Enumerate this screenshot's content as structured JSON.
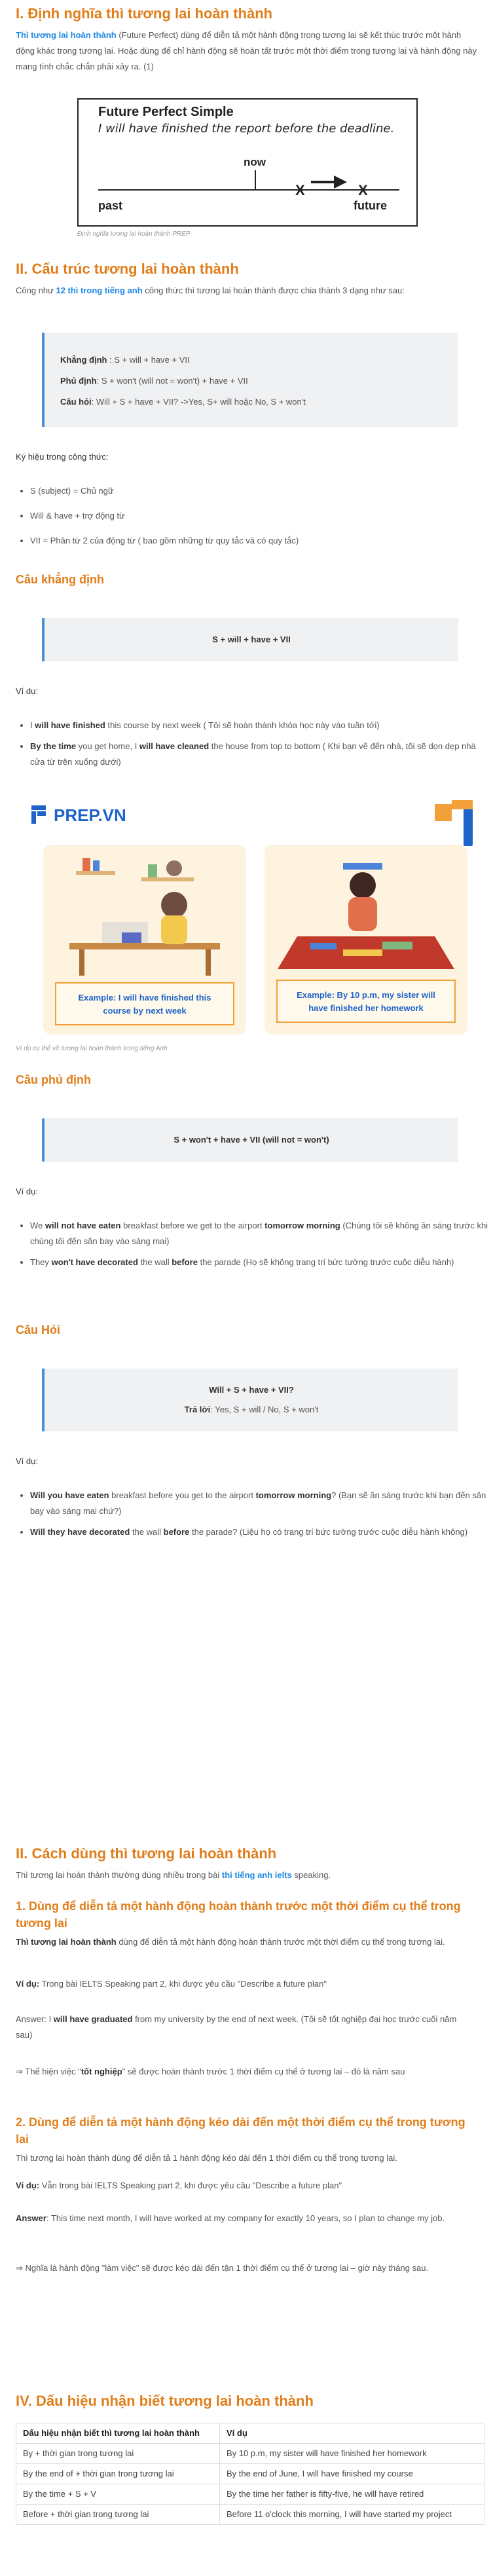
{
  "s1": {
    "title": "I. Định nghĩa thì tương lai hoàn thành",
    "intro_link": "Thì tương lai hoàn thành",
    "intro_rest": " (Future Perfect) dùng để diễn tả một hành động trong tương lai sẽ kết thúc trước một hành động khác trong tương lai. Hoặc dùng để chỉ hành động sẽ hoàn tất trước một thời điểm trong tương lai và hành động này mang tính chắc chắn phải xảy ra. (1)",
    "diagram": {
      "title": "Future Perfect Simple",
      "sentence": "I will have finished the report before the deadline.",
      "now": "now",
      "past": "past",
      "future": "future",
      "x1": "X",
      "x2": "X"
    },
    "caption": "Định nghĩa tương lai hoàn thành PREP"
  },
  "s2": {
    "title": "II. Cấu trúc tương lai hoàn thành",
    "intro_pre": "Công như ",
    "intro_link": "12 thì trong tiếng anh",
    "intro_post": " công thức thì tương lai hoàn thành được chia thành 3 dạng như sau:",
    "formula": {
      "l1_label": "Khẳng định",
      "l1": " : S + will + have + VII",
      "l2_label": "Phủ định",
      "l2": ": S + won't (will not = won't) + have + VII",
      "l3_label": "Câu hỏi",
      "l3": ": Will + S + have + VII? ->Yes, S+ will hoặc No, S + won't"
    },
    "symbols_title": "Ký hiệu trong công thức:",
    "symbols": [
      "S (subject) = Chủ ngữ",
      "Will & have + trợ động từ",
      "VII = Phân từ 2 của động từ ( bao gồm những từ quy tắc và có quy tắc)"
    ],
    "pos": {
      "title": "Câu khẳng định",
      "formula": "S + will + have + VII",
      "vidu": "Ví dụ:",
      "ex1_pre": "I ",
      "ex1_b": "will have finished",
      "ex1_post": " this course by next week ( Tôi sẽ hoàn thành khóa học này vào tuần tới)",
      "ex2_b1": "By the time",
      "ex2_m1": " you get home, I ",
      "ex2_b2": "will have cleaned",
      "ex2_post": " the house from top to bottom ( Khi bạn về đến nhà, tôi sẽ dọn dẹp nhà cửa từ trên xuống dưới)"
    },
    "illus": {
      "brand": "PREP.VN",
      "card1": "Example: I will have finished this course by next week",
      "card2": "Example: By 10 p.m, my sister will have finished her homework",
      "caption": "Ví dụ cụ thể về tương lai hoàn thành trong tiếng Anh"
    },
    "neg": {
      "title": "Câu phủ định",
      "formula": "S + won't + have + VII (will not = won't)",
      "vidu": "Ví dụ:",
      "ex1_pre": "We ",
      "ex1_b": "will not have eaten",
      "ex1_m": " breakfast before we get to the airport ",
      "ex1_b2": "tomorrow morning",
      "ex1_post": " (Chúng tôi sẽ không ăn sáng trước khi chúng tôi đến sân bay vào sáng mai)",
      "ex2_pre": "They ",
      "ex2_b": "won't have decorated",
      "ex2_m": " the wall ",
      "ex2_b2": "before",
      "ex2_post": " the parade (Họ sẽ không trang trí bức tường trước cuộc diễu hành)"
    },
    "q": {
      "title": "Câu Hỏi",
      "formula1": "Will + S + have + VII?",
      "formula2_label": "Trả lời",
      "formula2": ": Yes, S + will / No, S + won't",
      "vidu": "Ví dụ:",
      "ex1_b": "Will you have eaten",
      "ex1_m": " breakfast before you get to the airport ",
      "ex1_b2": "tomorrow morning",
      "ex1_post": "? (Bạn sẽ ăn sáng trước khi bạn đến sân bay vào sáng mai chứ?)",
      "ex2_b": "Will they have decorated",
      "ex2_m": " the wall ",
      "ex2_b2": "before",
      "ex2_post": " the parade? (Liệu họ có trang trí bức tường trước cuộc diễu hành không)"
    }
  },
  "s3": {
    "title": "II. Cách dùng thì tương lai hoàn thành",
    "intro_pre": "Thì tương lai hoàn thành thường dùng nhiều trong bài ",
    "intro_link": "thi tiếng anh ielts",
    "intro_post": " speaking.",
    "u1": {
      "title": "1. Dùng để diễn tả một hành động hoàn thành trước một thời điểm cụ thể trong tương lai",
      "desc_b": "Thì tương lai hoàn thành",
      "desc": " dùng để diễn tả một hành động hoàn thành trước một thời điểm cụ thể trong tương lai.",
      "vd_label": "Ví dụ:",
      "vd": " Trong bài IELTS Speaking part 2, khi được yêu cầu \"Describe a future plan\"",
      "ans_pre": "Answer: I ",
      "ans_b": "will have graduated",
      "ans_post": " from my university by the end of next week. (Tôi sẽ tốt nghiệp đại học trước cuối năm sau)",
      "note_pre": "⇒ Thể hiện việc \"",
      "note_b": "tốt nghiệp",
      "note_post": "\" sẽ được hoàn thành trước 1 thời điểm cụ thể ở tương lai – đó là năm sau"
    },
    "u2": {
      "title": "2. Dùng để diễn tả một hành động kéo dài đến một thời điểm cụ thể trong tương lai",
      "desc": "Thì tương lai hoàn thành dùng để diễn tả 1 hành động kéo dài đến 1 thời điểm cụ thể trong tương lai.",
      "vd_label": "Ví dụ:",
      "vd": " Vẫn trong bài IELTS Speaking part 2, khi được yêu cầu \"Describe a future plan\"",
      "ans_label": "Answer",
      "ans": ": This time next month, I will have worked at my company for exactly 10 years, so I plan to change my job.",
      "note": "⇒ Nghĩa là hành động \"làm việc\" sẽ được kéo dài đến tận 1 thời điểm cụ thể ở tương lai – giờ này tháng sau."
    }
  },
  "s4": {
    "title": "IV. Dấu hiệu nhận biết tương lai hoàn thành",
    "headers": [
      "Dấu hiệu nhận biết thì tương lai hoàn thành",
      "Ví dụ"
    ],
    "rows": [
      [
        "By + thời gian trong tương lai",
        "By 10 p.m, my sister will have finished her homework"
      ],
      [
        "By the end of + thời gian trong tương lai",
        "By the end of June, I will have finished my course"
      ],
      [
        "By the time + S + V",
        "By the time her father is fifty-five, he will have retired"
      ],
      [
        "Before + thời gian trong tương lai",
        "Before 11 o'clock this morning, I will have started my project"
      ]
    ]
  }
}
